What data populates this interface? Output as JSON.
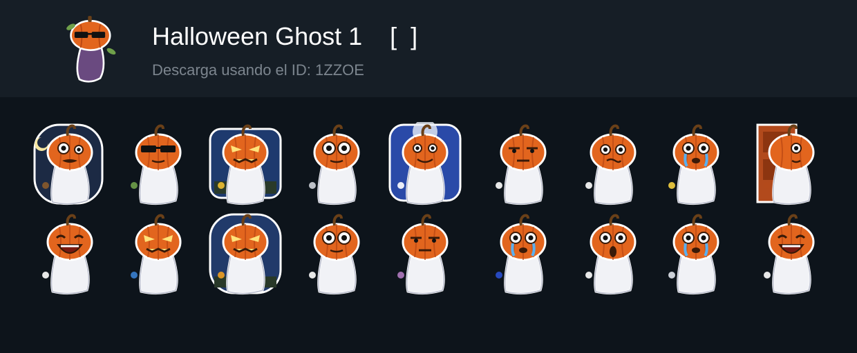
{
  "pack": {
    "title": "Halloween Ghost 1    [  ]",
    "subtitle": "Descarga usando el ID: 1ZZOE"
  },
  "stickers": [
    {
      "name": "sticker-graveyard-scared",
      "icon": "pumpkin-ghost-graveyard",
      "theme": "dark-rounded",
      "face": "scared",
      "accent": "#8a5a2b"
    },
    {
      "name": "sticker-sunglasses",
      "icon": "pumpkin-ghost-sunglasses",
      "theme": "none",
      "face": "shades",
      "accent": "#6fa04a"
    },
    {
      "name": "sticker-hi-graveyard",
      "icon": "pumpkin-ghost-hi",
      "theme": "night-graveyard",
      "face": "angry",
      "accent": "#f0c030"
    },
    {
      "name": "sticker-vibrating",
      "icon": "pumpkin-ghost-shaking",
      "theme": "none",
      "face": "big-eyes",
      "accent": "#d0d4dc"
    },
    {
      "name": "sticker-flying-moon",
      "icon": "pumpkin-ghost-flying",
      "theme": "blue-moon",
      "face": "smile",
      "accent": "#ffffff"
    },
    {
      "name": "sticker-unimpressed",
      "icon": "pumpkin-ghost-unimpressed",
      "theme": "none",
      "face": "bored",
      "accent": "#ffffff"
    },
    {
      "name": "sticker-confused",
      "icon": "pumpkin-ghost-confused",
      "theme": "none",
      "face": "confused",
      "accent": "#ffffff"
    },
    {
      "name": "sticker-crying-candles",
      "icon": "pumpkin-ghost-candles",
      "theme": "none",
      "face": "cry",
      "accent": "#f5d040"
    },
    {
      "name": "sticker-door-peek",
      "icon": "pumpkin-ghost-door",
      "theme": "door",
      "face": "peek",
      "accent": "#b24a1c"
    },
    {
      "name": "sticker-laughing",
      "icon": "pumpkin-ghost-laughing",
      "theme": "none",
      "face": "laugh",
      "accent": "#ffffff"
    },
    {
      "name": "sticker-laptop-angry",
      "icon": "pumpkin-ghost-laptop",
      "theme": "none",
      "face": "angry",
      "accent": "#3a7fd0"
    },
    {
      "name": "sticker-facepalm-night",
      "icon": "pumpkin-ghost-facepalm",
      "theme": "night",
      "face": "angry",
      "accent": "#f0a020"
    },
    {
      "name": "sticker-shrug",
      "icon": "pumpkin-ghost-shrug",
      "theme": "none",
      "face": "big-eyes",
      "accent": "#ffffff"
    },
    {
      "name": "sticker-smug-steam",
      "icon": "pumpkin-ghost-smug",
      "theme": "none",
      "face": "bored",
      "accent": "#b07ac0"
    },
    {
      "name": "sticker-tears",
      "icon": "pumpkin-ghost-tears",
      "theme": "none",
      "face": "cry",
      "accent": "#2a4fd0"
    },
    {
      "name": "sticker-shocked",
      "icon": "pumpkin-ghost-shocked",
      "theme": "none",
      "face": "shock",
      "accent": "#ffffff"
    },
    {
      "name": "sticker-melting",
      "icon": "pumpkin-ghost-melting",
      "theme": "none",
      "face": "cry",
      "accent": "#e0e4ec"
    },
    {
      "name": "sticker-thumbs-up",
      "icon": "pumpkin-ghost-thumbs-up",
      "theme": "none",
      "face": "laugh",
      "accent": "#ffffff"
    }
  ]
}
